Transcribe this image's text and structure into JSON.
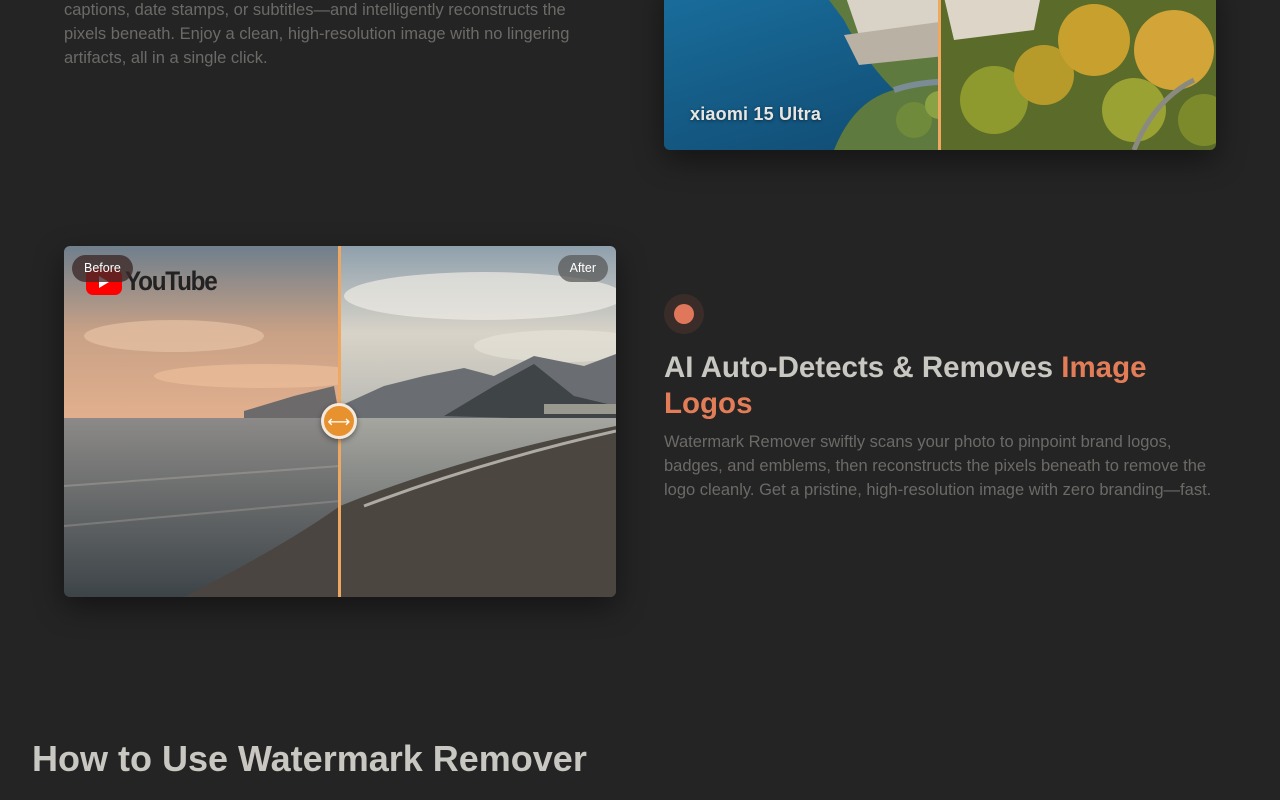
{
  "previous_section": {
    "description": "captions, date stamps, or subtitles—and intelligently reconstructs the pixels beneath. Enjoy a clean, high-resolution image with no lingering artifacts, all in a single click."
  },
  "top_comparison": {
    "caption": "xiaomi 15 Ultra"
  },
  "logo_comparison": {
    "before_label": "Before",
    "after_label": "After",
    "watermark_text": "YouTube",
    "handle_glyph": "⟷",
    "slider_position": 0.5
  },
  "feature": {
    "icon": "dot-icon",
    "title_plain": "AI Auto-Detects & Removes ",
    "title_accent": "Image Logos",
    "description": "Watermark Remover swiftly scans your photo to pinpoint brand logos, badges, and emblems, then reconstructs the pixels beneath to remove the logo cleanly. Get a pristine, high-resolution image with zero branding—fast."
  },
  "how_to": {
    "title": "How to Use Watermark Remover"
  },
  "colors": {
    "background": "#242424",
    "accent": "#e27d58",
    "divider": "#f0a860",
    "handle": "#e8912f",
    "heading": "#c9c7c2",
    "muted_text": "#6c6a67"
  }
}
